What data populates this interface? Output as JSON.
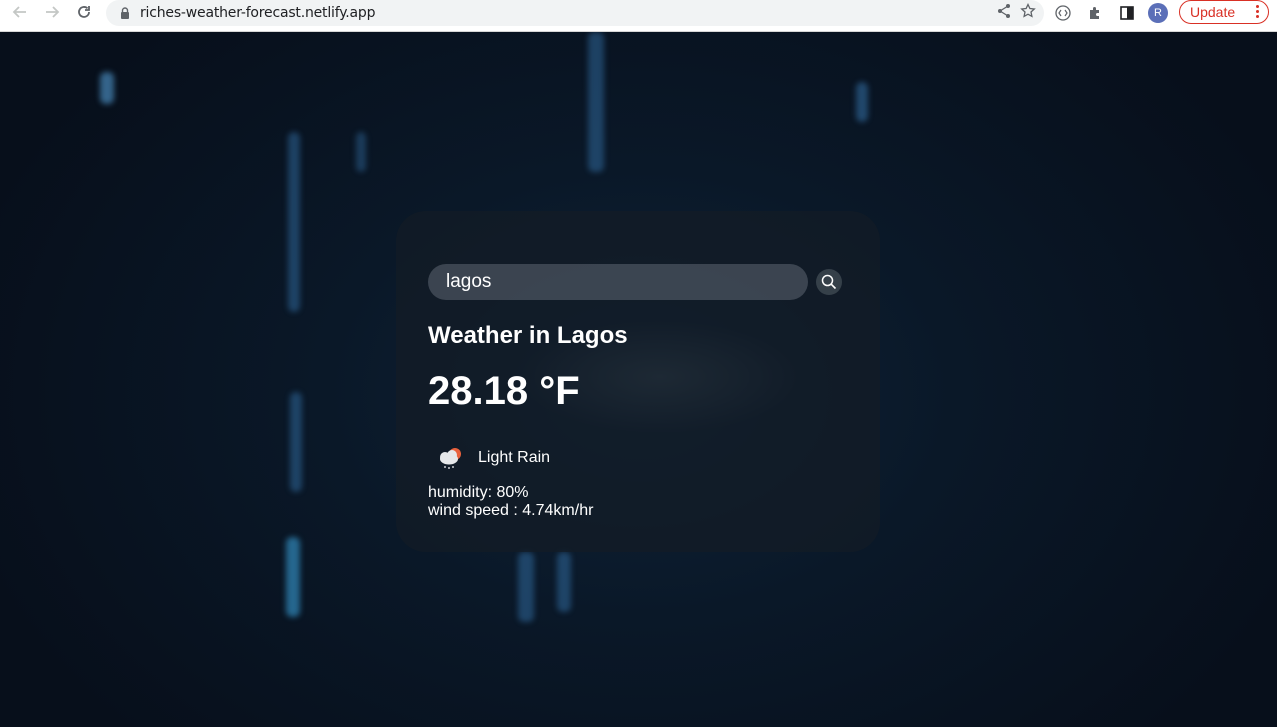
{
  "browser": {
    "url": "riches-weather-forecast.netlify.app",
    "profile_initial": "R",
    "update_label": "Update"
  },
  "search": {
    "value": "lagos"
  },
  "weather": {
    "city_heading": "Weather in Lagos",
    "temperature": "28.18 °F",
    "description": "Light Rain",
    "humidity": "humidity: 80%",
    "wind_speed": "wind speed : 4.74km/hr",
    "icon": "cloud-rain-sun-icon"
  }
}
